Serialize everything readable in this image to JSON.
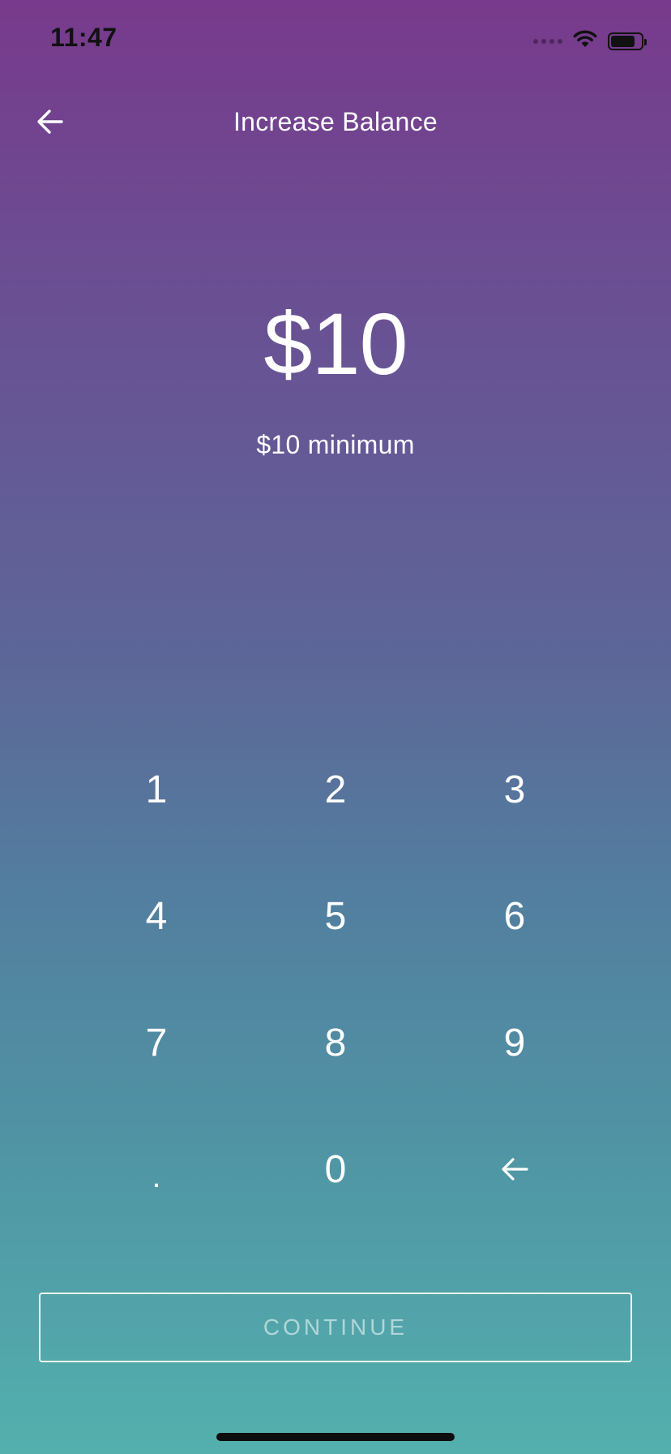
{
  "status_bar": {
    "time": "11:47",
    "icons": [
      "signal-dots-icon",
      "wifi-icon",
      "battery-icon"
    ],
    "battery_level": 0.8
  },
  "nav": {
    "back_icon": "arrow-left-icon",
    "title": "Increase Balance"
  },
  "amount": {
    "value": "$10",
    "minimum_text": "$10 minimum"
  },
  "keypad": {
    "keys": [
      {
        "label": "1",
        "name": "key-1"
      },
      {
        "label": "2",
        "name": "key-2"
      },
      {
        "label": "3",
        "name": "key-3"
      },
      {
        "label": "4",
        "name": "key-4"
      },
      {
        "label": "5",
        "name": "key-5"
      },
      {
        "label": "6",
        "name": "key-6"
      },
      {
        "label": "7",
        "name": "key-7"
      },
      {
        "label": "8",
        "name": "key-8"
      },
      {
        "label": "9",
        "name": "key-9"
      },
      {
        "label": ".",
        "name": "key-decimal"
      },
      {
        "label": "0",
        "name": "key-0"
      }
    ],
    "delete_icon": "backspace-arrow-icon"
  },
  "continue_button": {
    "label": "CONTINUE"
  },
  "colors": {
    "gradient_top": "#783a8c",
    "gradient_bottom": "#53b0ad",
    "text": "#ffffff"
  }
}
